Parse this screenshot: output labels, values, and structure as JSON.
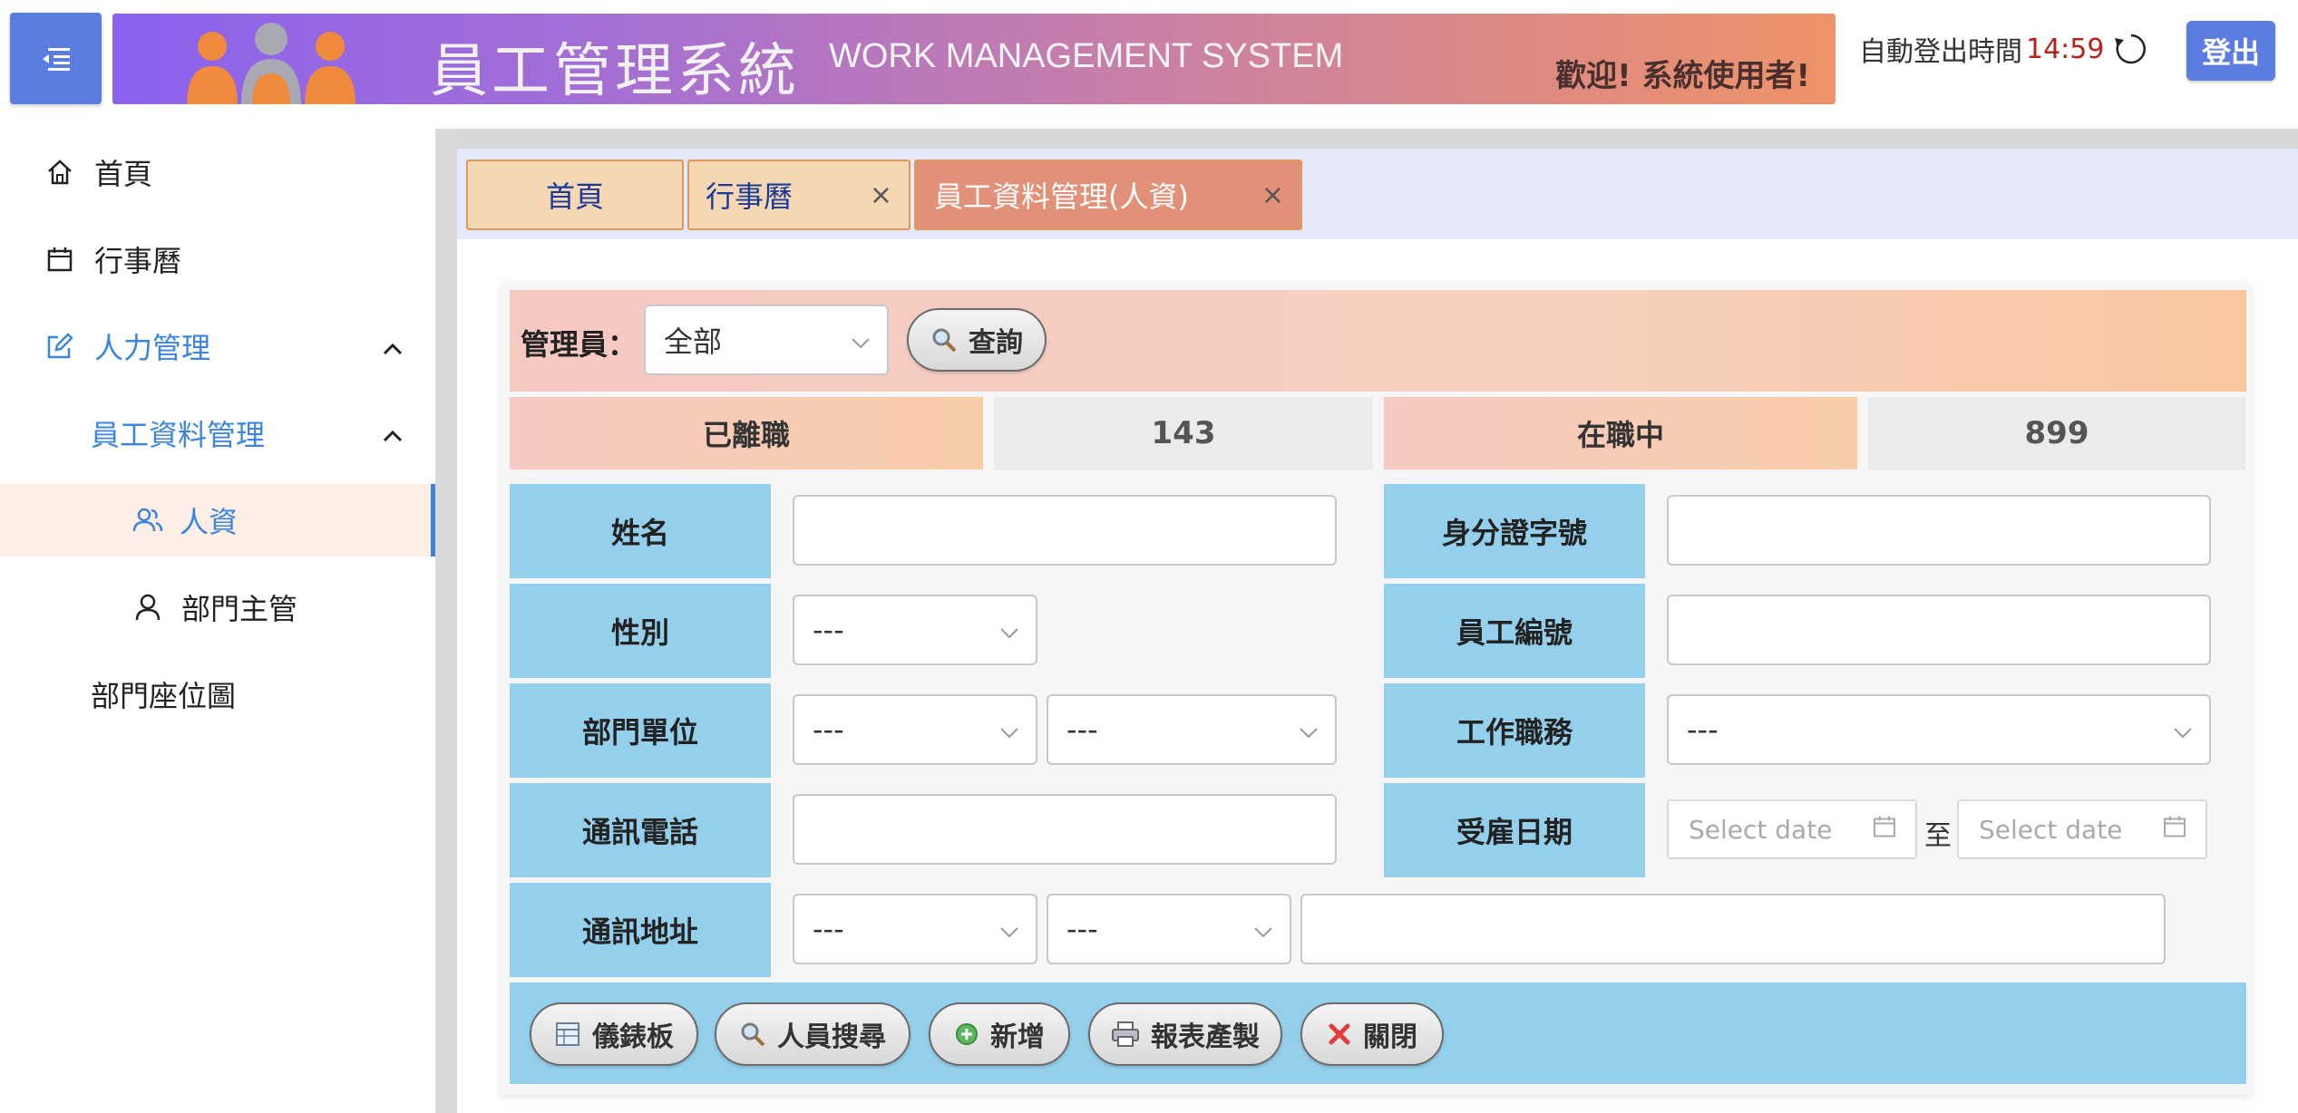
{
  "header": {
    "banner_title_zh": "員工管理系統",
    "banner_title_en": "WORK MANAGEMENT SYSTEM",
    "welcome": "歡迎! 系統使用者!",
    "auto_logout_label": "自動登出時間",
    "auto_logout_time": "14:59",
    "logout_label": "登出"
  },
  "sidebar": {
    "items": [
      {
        "label": "首頁",
        "icon": "home-icon"
      },
      {
        "label": "行事曆",
        "icon": "calendar-icon"
      },
      {
        "label": "人力管理",
        "icon": "edit-icon"
      },
      {
        "label": "員工資料管理"
      },
      {
        "label": "人資",
        "icon": "users-icon"
      },
      {
        "label": "部門主管",
        "icon": "user-icon"
      },
      {
        "label": "部門座位圖"
      }
    ]
  },
  "tabs": [
    {
      "label": "首頁"
    },
    {
      "label": "行事曆",
      "close": "×"
    },
    {
      "label": "員工資料管理(人資)",
      "close": "×"
    }
  ],
  "filter": {
    "admin_label": "管理員：",
    "admin_value": "全部",
    "search_label": "查詢"
  },
  "stats": {
    "resigned_label": "已離職",
    "resigned_count": "143",
    "active_label": "在職中",
    "active_count": "899"
  },
  "form": {
    "name_label": "姓名",
    "id_label": "身分證字號",
    "gender_label": "性別",
    "gender_value": "---",
    "emp_no_label": "員工編號",
    "dept_label": "部門單位",
    "dept_value_1": "---",
    "dept_value_2": "---",
    "job_label": "工作職務",
    "job_value": "---",
    "phone_label": "通訊電話",
    "hire_label": "受雇日期",
    "date_placeholder_1": "Select date",
    "date_to": "至",
    "date_placeholder_2": "Select date",
    "address_label": "通訊地址",
    "addr_value_1": "---",
    "addr_value_2": "---"
  },
  "actions": [
    {
      "label": "儀錶板",
      "icon": "dashboard-icon"
    },
    {
      "label": "人員搜尋",
      "icon": "search-icon"
    },
    {
      "label": "新增",
      "icon": "add-icon"
    },
    {
      "label": "報表產製",
      "icon": "printer-icon"
    },
    {
      "label": "關閉",
      "icon": "close-icon"
    }
  ],
  "colors": {
    "accent_blue": "#3b84e0",
    "field_label_bg": "#94cfec",
    "logout_time": "#b5231b",
    "tab_active_bg": "#e39078"
  }
}
